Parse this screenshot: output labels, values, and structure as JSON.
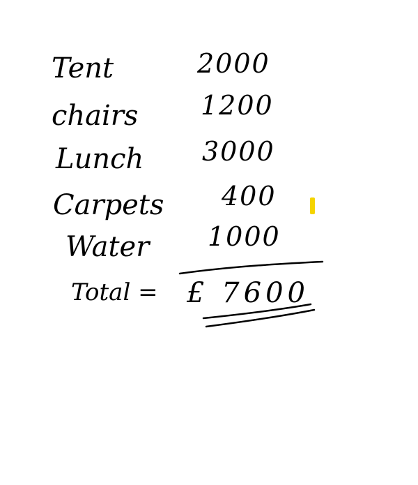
{
  "items": [
    {
      "label": "Tent",
      "amount": "2000"
    },
    {
      "label": "chairs",
      "amount": "1200"
    },
    {
      "label": "Lunch",
      "amount": "3000"
    },
    {
      "label": "Carpets",
      "amount": "400"
    },
    {
      "label": "Water",
      "amount": "1000"
    }
  ],
  "total": {
    "label": "Total =",
    "value": "£ 7600"
  },
  "colors": {
    "ink": "#000000",
    "highlighter": "#f5d400",
    "background": "#ffffff"
  }
}
